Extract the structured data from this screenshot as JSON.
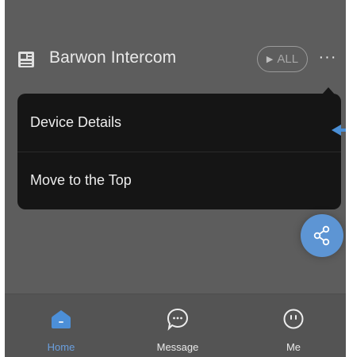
{
  "device": {
    "name": "Barwon Intercom",
    "icon": "intercom-device-icon"
  },
  "header": {
    "all_button_label": "ALL",
    "all_button_icon": "play-triangle-icon",
    "more_button_label": "···"
  },
  "menu": {
    "items": [
      {
        "label": "Device Details"
      },
      {
        "label": "Move to the Top"
      }
    ]
  },
  "fab": {
    "icon": "share-icon",
    "color": "#5d95d4"
  },
  "tabbar": {
    "tabs": [
      {
        "label": "Home",
        "icon": "home-icon",
        "active": true
      },
      {
        "label": "Message",
        "icon": "message-bubble-icon",
        "active": false
      },
      {
        "label": "Me",
        "icon": "me-face-icon",
        "active": false
      }
    ]
  },
  "colors": {
    "background": "#5d5d5d",
    "menu_background": "#151515",
    "accent": "#6a9fde"
  }
}
